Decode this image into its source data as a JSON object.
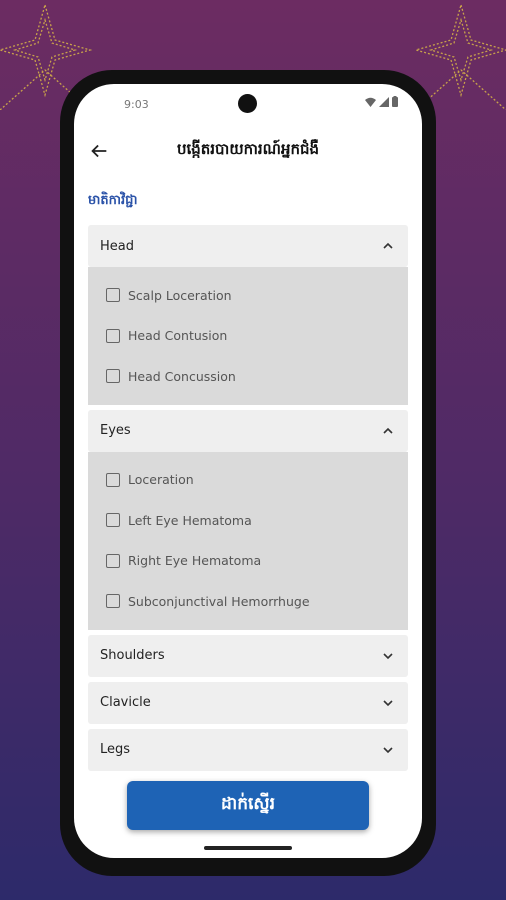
{
  "status_bar": {
    "time": "9:03"
  },
  "header": {
    "title": "បង្កើតរបាយការណ៍អ្នកជំងឺ"
  },
  "section_title": "មាតិកាវិជ្ជា",
  "groups": [
    {
      "label": "Head",
      "expanded": true,
      "options": [
        "Scalp Loceration",
        "Head Contusion",
        "Head Concussion"
      ]
    },
    {
      "label": "Eyes",
      "expanded": true,
      "options": [
        "Loceration",
        "Left Eye Hematoma",
        "Right Eye Hematoma",
        "Subconjunctival Hemorrhuge"
      ]
    },
    {
      "label": "Shoulders",
      "expanded": false
    },
    {
      "label": "Clavicle",
      "expanded": false
    },
    {
      "label": "Legs",
      "expanded": false
    }
  ],
  "submit_label": "ដាក់ស្នើរ",
  "colors": {
    "accent": "#1e63b5",
    "background_top": "#6c2c62",
    "background_bottom": "#2d2a6a"
  }
}
